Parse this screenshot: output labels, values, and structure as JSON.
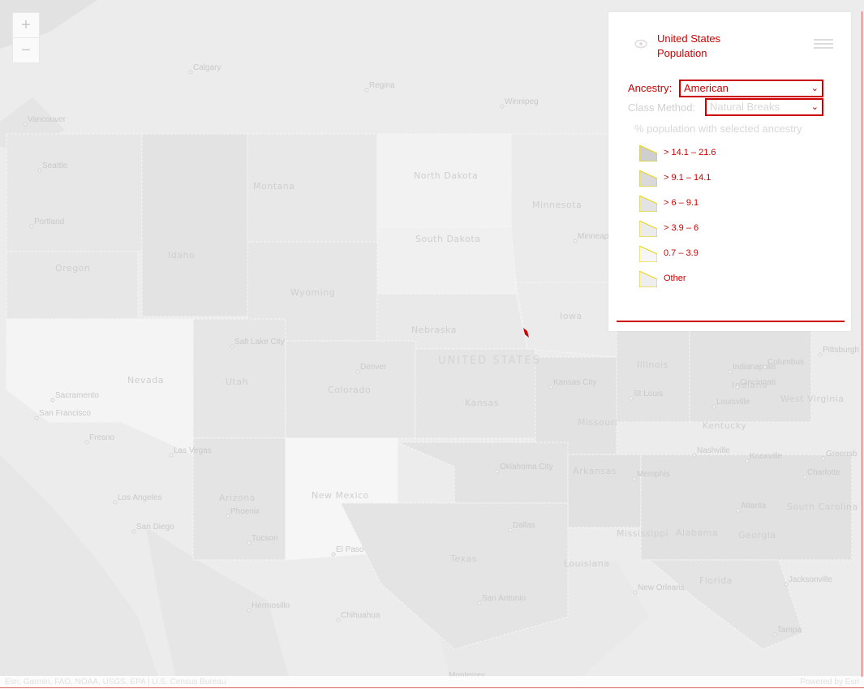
{
  "zoom": {
    "in_label": "+",
    "out_label": "−"
  },
  "panel": {
    "title": "United States Population",
    "ancestry": {
      "label": "Ancestry:",
      "value": "American"
    },
    "class_method": {
      "label": "Class Method:",
      "value": "Natural Breaks"
    },
    "legend_subtitle": "% population with selected ancestry",
    "legend": [
      {
        "label": "> 14.1 – 21.6",
        "color": "#cfcfcf"
      },
      {
        "label": "> 9.1 – 14.1",
        "color": "#dadada"
      },
      {
        "label": "> 6 – 9.1",
        "color": "#e3e3e3"
      },
      {
        "label": "> 3.9 – 6",
        "color": "#ebebeb"
      },
      {
        "label": "0.7 – 3.9",
        "color": "#f6f6f6"
      },
      {
        "label": "Other",
        "color": "#eeeeee"
      }
    ]
  },
  "map": {
    "country_label": "UNITED STATES",
    "state_labels": [
      "Montana",
      "North Dakota",
      "Minnesota",
      "South Dakota",
      "Idaho",
      "Oregon",
      "Wyoming",
      "Nebraska",
      "Iowa",
      "Nevada",
      "Utah",
      "Colorado",
      "Kansas",
      "Missouri",
      "Illinois",
      "Indiana",
      "Kentucky",
      "Arizona",
      "New Mexico",
      "Oklahoma",
      "Arkansas",
      "Texas",
      "Louisiana",
      "Mississippi",
      "Alabama",
      "Georgia",
      "South Carolina",
      "Florida",
      "West Virginia"
    ],
    "city_labels": [
      "Calgary",
      "Regina",
      "Winnipeg",
      "Vancouver",
      "Seattle",
      "Portland",
      "Salt Lake City",
      "Denver",
      "Sacramento",
      "San Francisco",
      "Fresno",
      "Las Vegas",
      "Los Angeles",
      "San Diego",
      "Phoenix",
      "Tucson",
      "El Paso",
      "Hermosillo",
      "Chihuahua",
      "Dallas",
      "San Antonio",
      "Oklahoma City",
      "Kansas City",
      "St Louis",
      "Indianapolis",
      "Columbus",
      "Pittsburgh",
      "Cincinnati",
      "Louisville",
      "Nashville",
      "Knoxville",
      "Greensb",
      "Charlotte",
      "Memphis",
      "Atlanta",
      "New Orleans",
      "Jacksonville",
      "Tampa",
      "Monterrey",
      "Minneap"
    ]
  },
  "attribution": {
    "text": "Esri, Garmin, FAO, NOAA, USGS, EPA | U.S. Census Bureau",
    "powered": "Powered by Esri"
  }
}
